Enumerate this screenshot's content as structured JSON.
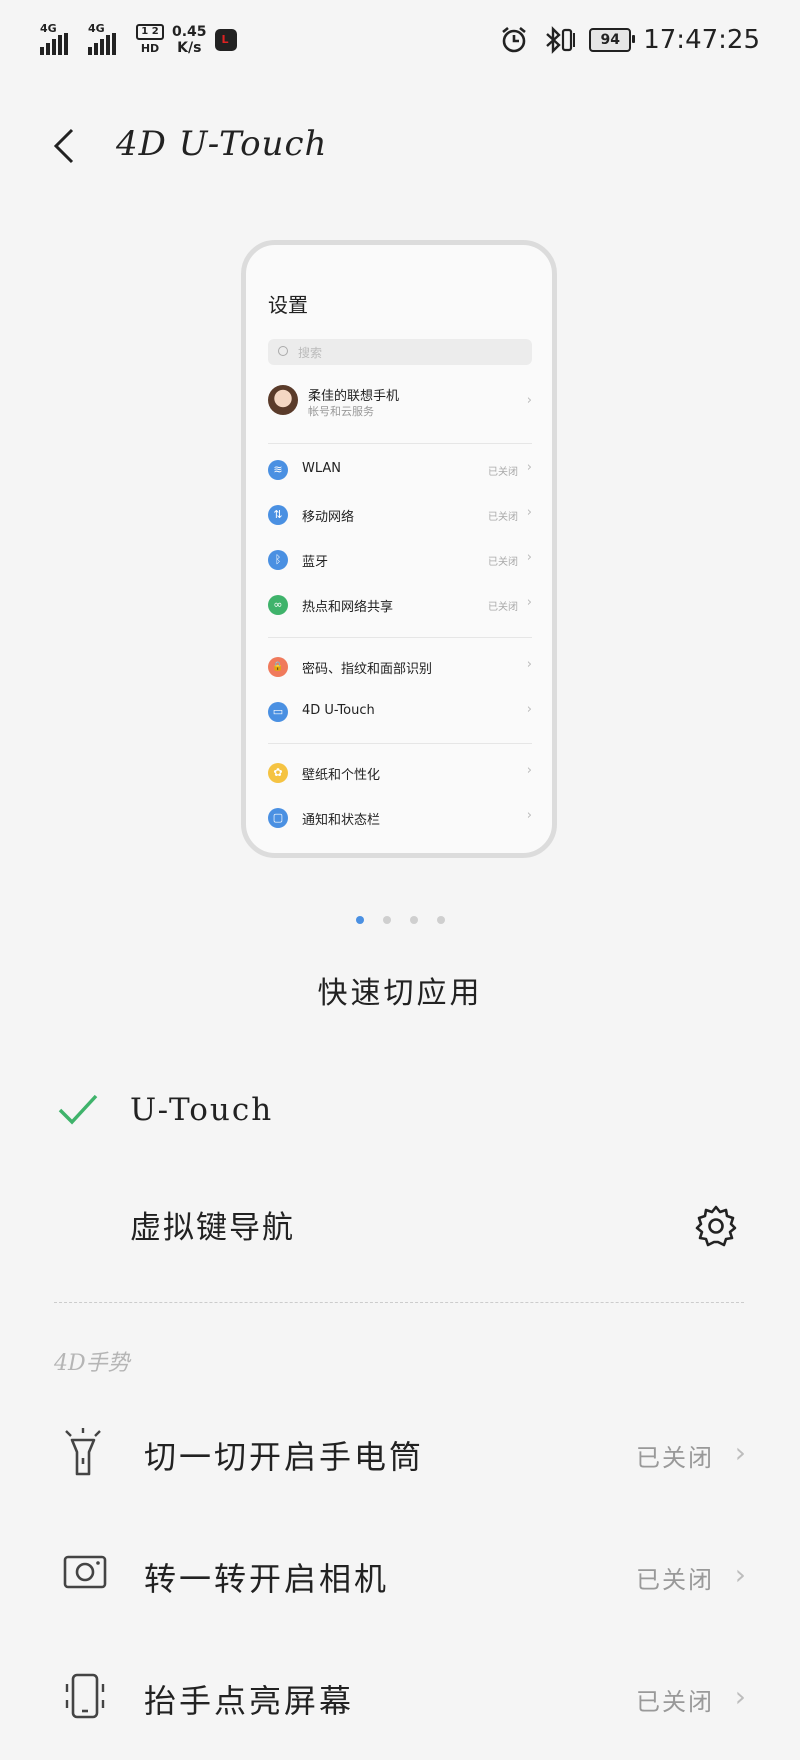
{
  "status_bar": {
    "net1": "4G",
    "net2": "4G",
    "hd_top": "1 2",
    "hd_bottom": "HD",
    "speed_value": "0.45",
    "speed_unit": "K/s",
    "notif_letter": "L",
    "battery": "94",
    "time": "17:47:25"
  },
  "header": {
    "title": "4D U-Touch"
  },
  "preview": {
    "title": "设置",
    "search_placeholder": "搜索",
    "account_name": "柔佳的联想手机",
    "account_sub": "帐号和云服务",
    "rows": [
      {
        "label": "WLAN",
        "status": "已关闭",
        "color": "#4a90e2",
        "glyph": "≋"
      },
      {
        "label": "移动网络",
        "status": "已关闭",
        "color": "#4a90e2",
        "glyph": "⇅"
      },
      {
        "label": "蓝牙",
        "status": "已关闭",
        "color": "#4a90e2",
        "glyph": "ᛒ"
      },
      {
        "label": "热点和网络共享",
        "status": "已关闭",
        "color": "#3fb36b",
        "glyph": "∞"
      },
      {
        "label": "密码、指纹和面部识别",
        "status": "",
        "color": "#f07a5c",
        "glyph": "🔒"
      },
      {
        "label": "4D U-Touch",
        "status": "",
        "color": "#4a90e2",
        "glyph": "▭"
      },
      {
        "label": "壁纸和个性化",
        "status": "",
        "color": "#f5c342",
        "glyph": "✿"
      },
      {
        "label": "通知和状态栏",
        "status": "",
        "color": "#4a90e2",
        "glyph": "▢"
      }
    ]
  },
  "carousel": {
    "caption": "快速切应用",
    "page_count": 4,
    "active_page": 1
  },
  "nav_options": {
    "utouch": {
      "label": "U-Touch",
      "selected": true
    },
    "virtual_keys": {
      "label": "虚拟键导航",
      "selected": false
    }
  },
  "gestures": {
    "section_title": "4D手势",
    "items": [
      {
        "label": "切一切开启手电筒",
        "status": "已关闭",
        "icon": "flashlight-icon"
      },
      {
        "label": "转一转开启相机",
        "status": "已关闭",
        "icon": "camera-icon"
      },
      {
        "label": "抬手点亮屏幕",
        "status": "已关闭",
        "icon": "phone-raise-icon"
      }
    ]
  },
  "colors": {
    "accent_check": "#3fb36b",
    "active_dot": "#4a90e2"
  }
}
